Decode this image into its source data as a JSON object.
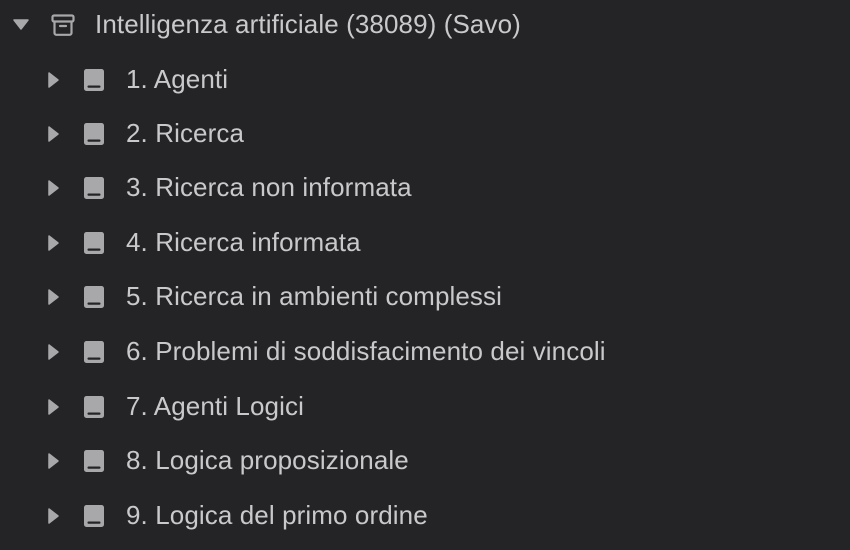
{
  "tree": {
    "root": {
      "label": "Intelligenza artificiale (38089) (Savo)",
      "expanded": true,
      "icon": "archive-icon"
    },
    "children": [
      {
        "label": "1. Agenti",
        "icon": "book-icon",
        "expanded": false
      },
      {
        "label": "2. Ricerca",
        "icon": "book-icon",
        "expanded": false
      },
      {
        "label": "3. Ricerca non informata",
        "icon": "book-icon",
        "expanded": false
      },
      {
        "label": "4. Ricerca informata",
        "icon": "book-icon",
        "expanded": false
      },
      {
        "label": "5. Ricerca in ambienti complessi",
        "icon": "book-icon",
        "expanded": false
      },
      {
        "label": "6. Problemi di soddisfacimento dei vincoli",
        "icon": "book-icon",
        "expanded": false
      },
      {
        "label": "7. Agenti Logici",
        "icon": "book-icon",
        "expanded": false
      },
      {
        "label": "8. Logica proposizionale",
        "icon": "book-icon",
        "expanded": false
      },
      {
        "label": "9. Logica del primo ordine",
        "icon": "book-icon",
        "expanded": false
      }
    ]
  },
  "colors": {
    "background": "#242426",
    "text": "#c9c9cb",
    "icon": "#a8a8aa"
  }
}
